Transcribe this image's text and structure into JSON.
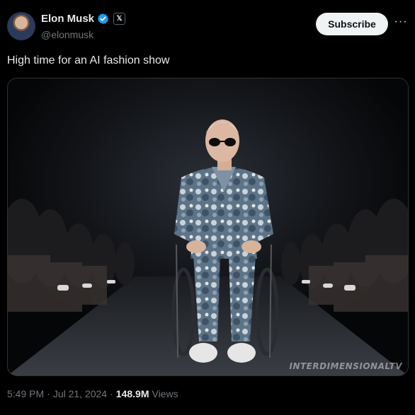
{
  "author": {
    "display_name": "Elon Musk",
    "handle": "@elonmusk",
    "verified_icon": "verified-badge-icon",
    "affiliation_icon": "x-logo-icon",
    "affiliation_label": "𝕏"
  },
  "actions": {
    "subscribe_label": "Subscribe",
    "more_label": "···"
  },
  "tweet": {
    "text": "High time for an AI fashion show"
  },
  "media": {
    "watermark": "INTERDIMENSIONALTV"
  },
  "meta": {
    "time": "5:49 PM",
    "separator1": "·",
    "date": "Jul 21, 2024",
    "separator2": "·",
    "views_count": "148.9M",
    "views_label": "Views"
  },
  "colors": {
    "background": "#000000",
    "text_primary": "#e7e9ea",
    "text_secondary": "#71767b",
    "verified_blue": "#1d9bf0",
    "subscribe_bg": "#eff3f4"
  }
}
